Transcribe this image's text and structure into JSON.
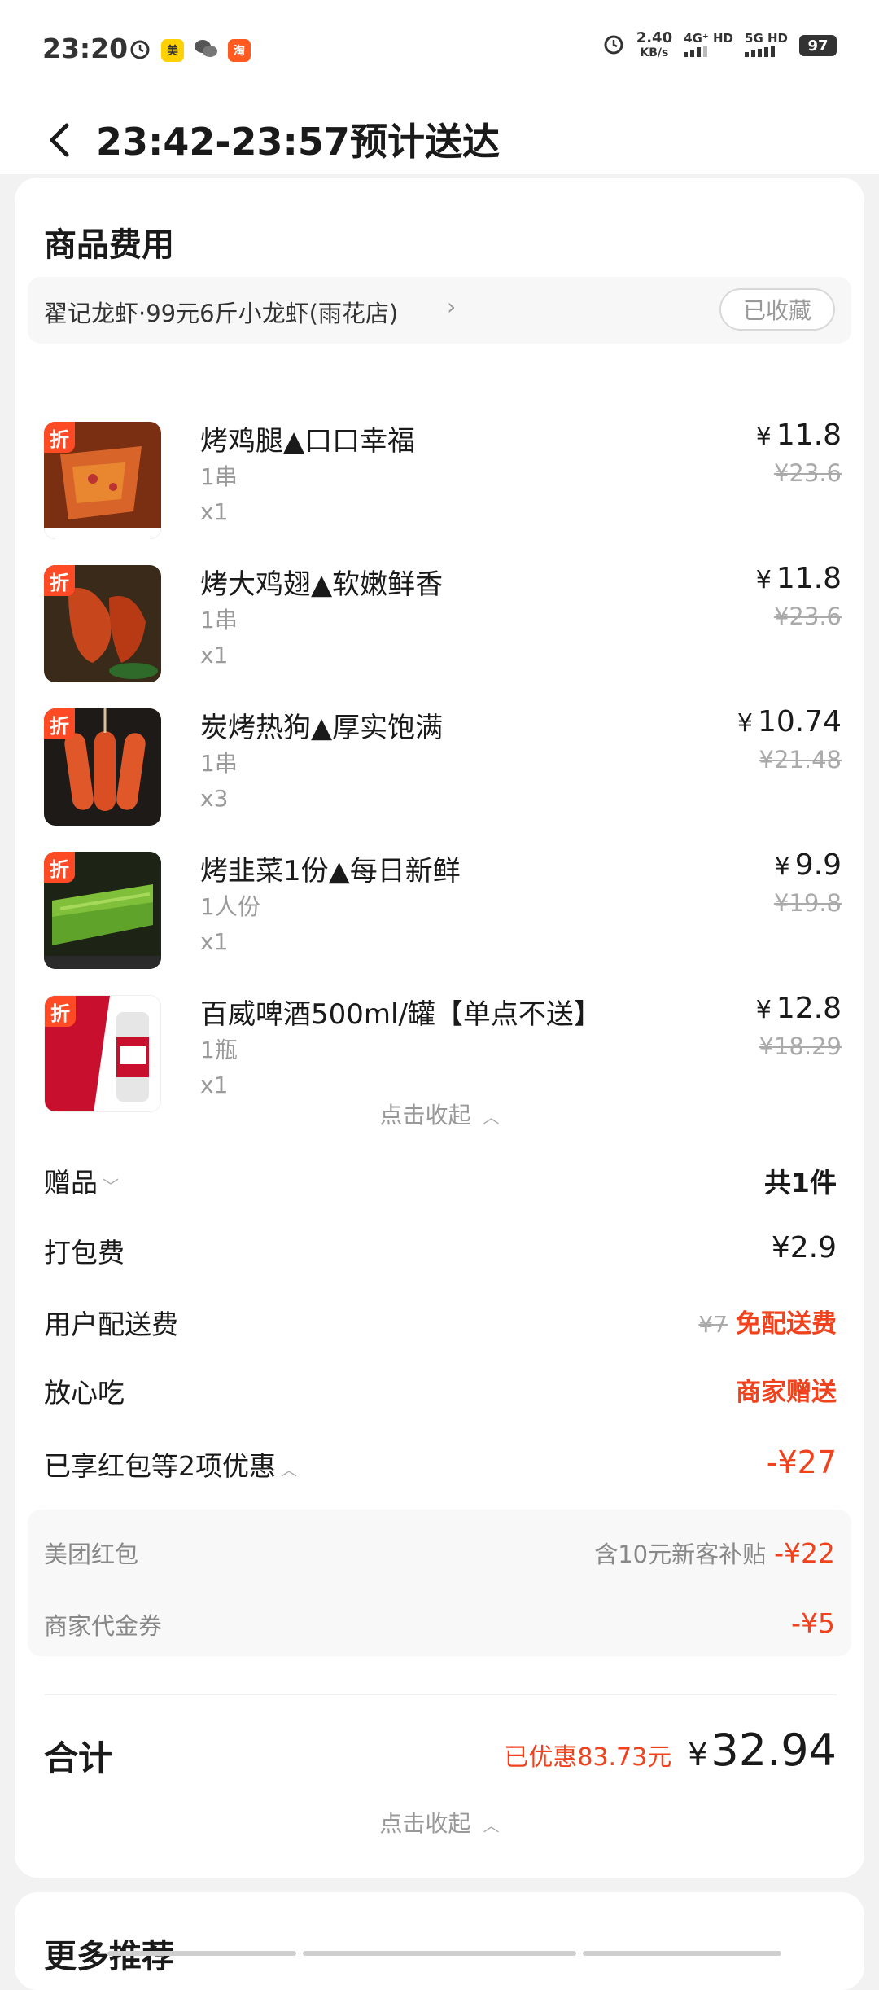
{
  "status_bar": {
    "time": "23:20",
    "speed_value": "2.40",
    "speed_unit": "KB/s",
    "net1": "4G⁺ HD",
    "net2": "5G HD",
    "battery": "97"
  },
  "header": {
    "title": "23:42-23:57预计送达"
  },
  "section_title": "商品费用",
  "shop": {
    "name": "翟记龙虾·99元6斤小龙虾(雨花店)",
    "fav_label": "已收藏"
  },
  "badge_text": "折",
  "currency": "¥",
  "items": [
    {
      "name": "烤鸡腿▲口口幸福",
      "spec": "1串",
      "qty": "x1",
      "price": "11.8",
      "original": "¥23.6"
    },
    {
      "name": "烤大鸡翅▲软嫩鲜香",
      "spec": "1串",
      "qty": "x1",
      "price": "11.8",
      "original": "¥23.6"
    },
    {
      "name": "炭烤热狗▲厚实饱满",
      "spec": "1串",
      "qty": "x3",
      "price": "10.74",
      "original": "¥21.48"
    },
    {
      "name": "烤韭菜1份▲每日新鲜",
      "spec": "1人份",
      "qty": "x1",
      "price": "9.9",
      "original": "¥19.8"
    },
    {
      "name": "百威啤酒500ml/罐【单点不送】",
      "spec": "1瓶",
      "qty": "x1",
      "price": "12.8",
      "original": "¥18.29"
    }
  ],
  "collapse_label": "点击收起",
  "fees": {
    "gift_label": "赠品",
    "gift_value": "共1件",
    "packing_label": "打包费",
    "packing_value": "¥2.9",
    "delivery_label": "用户配送费",
    "delivery_original": "¥7",
    "delivery_value": "免配送费",
    "safe_label": "放心吃",
    "safe_value": "商家赠送",
    "discount_label": "已享红包等2项优惠",
    "discount_value": "-¥27"
  },
  "discounts": [
    {
      "label": "美团红包",
      "note": "含10元新客补贴",
      "value": "-¥22"
    },
    {
      "label": "商家代金券",
      "note": "",
      "value": "-¥5"
    }
  ],
  "total": {
    "label": "合计",
    "saved": "已优惠83.73元",
    "amount": "32.94"
  },
  "more_title": "更多推荐",
  "colors": {
    "accent_red": "#f0421d",
    "badge_orange": "#ff4a26"
  }
}
